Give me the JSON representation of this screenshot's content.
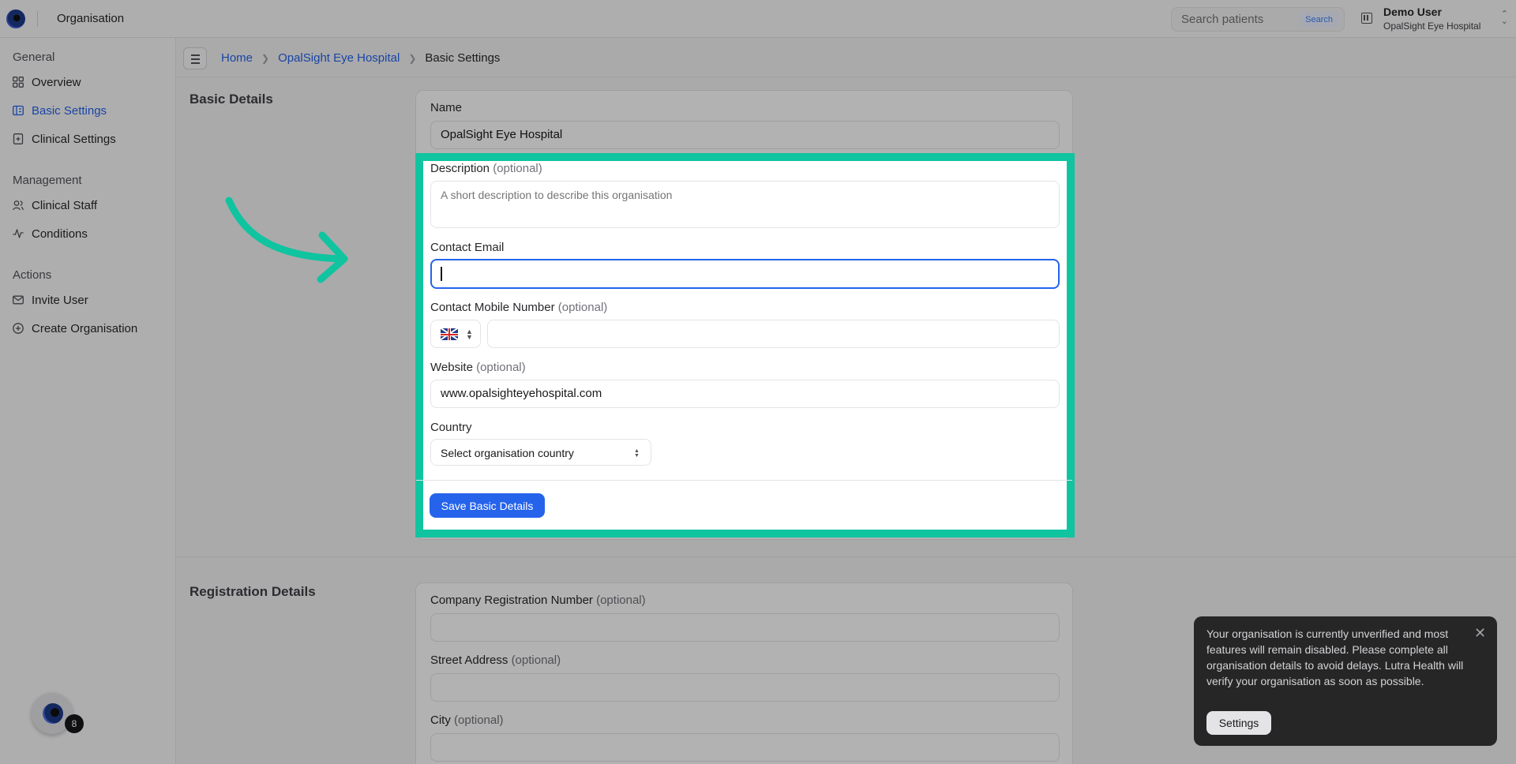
{
  "topbar": {
    "title": "Organisation",
    "search_placeholder": "Search patients",
    "search_button": "Search",
    "user_name": "Demo User",
    "user_org": "OpalSight Eye Hospital"
  },
  "sidebar": {
    "sections": [
      {
        "label": "General",
        "items": [
          {
            "label": "Overview",
            "icon": "grid-icon"
          },
          {
            "label": "Basic Settings",
            "icon": "settings-panel-icon",
            "active": true
          },
          {
            "label": "Clinical Settings",
            "icon": "clinical-icon"
          }
        ]
      },
      {
        "label": "Management",
        "items": [
          {
            "label": "Clinical Staff",
            "icon": "users-icon"
          },
          {
            "label": "Conditions",
            "icon": "activity-icon"
          }
        ]
      },
      {
        "label": "Actions",
        "items": [
          {
            "label": "Invite User",
            "icon": "mail-icon"
          },
          {
            "label": "Create Organisation",
            "icon": "plus-circle-icon"
          }
        ]
      }
    ],
    "notification_count": "8"
  },
  "breadcrumb": {
    "home": "Home",
    "org": "OpalSight Eye Hospital",
    "current": "Basic Settings"
  },
  "basic_details": {
    "title": "Basic Details",
    "name_label": "Name",
    "name_value": "OpalSight Eye Hospital",
    "description_label": "Description",
    "description_optional": "(optional)",
    "description_placeholder": "A short description to describe this organisation",
    "email_label": "Contact Email",
    "email_value": "",
    "mobile_label": "Contact Mobile Number",
    "mobile_optional": "(optional)",
    "mobile_value": "",
    "website_label": "Website",
    "website_optional": "(optional)",
    "website_value": "www.opalsighteyehospital.com",
    "country_label": "Country",
    "country_placeholder": "Select organisation country",
    "save_button": "Save Basic Details"
  },
  "registration_details": {
    "title": "Registration Details",
    "company_reg_label": "Company Registration Number",
    "company_reg_optional": "(optional)",
    "street_label": "Street Address",
    "street_optional": "(optional)",
    "city_label": "City",
    "city_optional": "(optional)"
  },
  "toast": {
    "message": "Your organisation is currently unverified and most features will remain disabled. Please complete all organisation details to avoid delays. Lutra Health will verify your organisation as soon as possible.",
    "button": "Settings"
  },
  "colors": {
    "accent": "#2563eb",
    "highlight": "#10c4a0"
  }
}
